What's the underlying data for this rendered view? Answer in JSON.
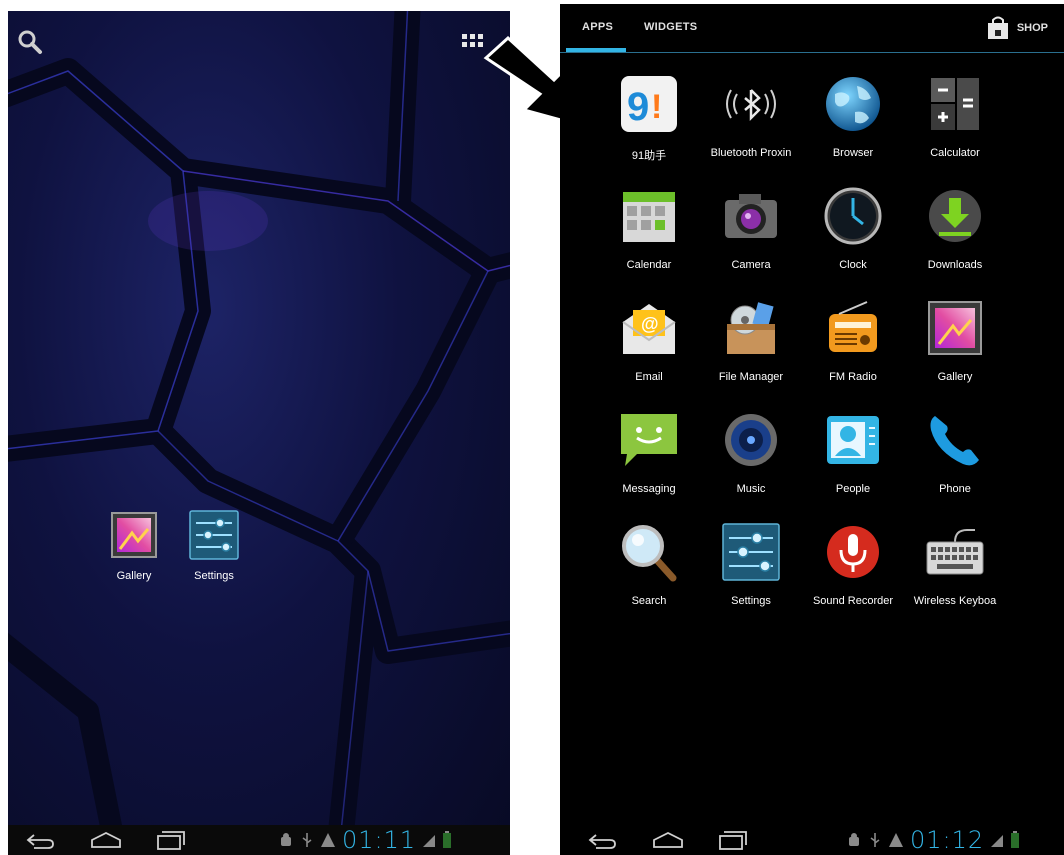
{
  "home": {
    "icons": [
      {
        "label": "Gallery",
        "icon": "gallery-icon"
      },
      {
        "label": "Settings",
        "icon": "settings-icon"
      }
    ],
    "clock": "01:11"
  },
  "drawer": {
    "tabs": [
      {
        "label": "APPS"
      },
      {
        "label": "WIDGETS"
      }
    ],
    "shop_label": "SHOP",
    "apps": [
      {
        "label": "91助手",
        "icon": "91-assistant-icon"
      },
      {
        "label": "Bluetooth Proxin",
        "icon": "bluetooth-icon"
      },
      {
        "label": "Browser",
        "icon": "globe-icon"
      },
      {
        "label": "Calculator",
        "icon": "calculator-icon"
      },
      {
        "label": "Calendar",
        "icon": "calendar-icon"
      },
      {
        "label": "Camera",
        "icon": "camera-icon"
      },
      {
        "label": "Clock",
        "icon": "clock-icon"
      },
      {
        "label": "Downloads",
        "icon": "download-icon"
      },
      {
        "label": "Email",
        "icon": "email-icon"
      },
      {
        "label": "File Manager",
        "icon": "file-manager-icon"
      },
      {
        "label": "FM Radio",
        "icon": "radio-icon"
      },
      {
        "label": "Gallery",
        "icon": "gallery-icon"
      },
      {
        "label": "Messaging",
        "icon": "messaging-icon"
      },
      {
        "label": "Music",
        "icon": "music-icon"
      },
      {
        "label": "People",
        "icon": "people-icon"
      },
      {
        "label": "Phone",
        "icon": "phone-icon"
      },
      {
        "label": "Search",
        "icon": "magnifier-icon"
      },
      {
        "label": "Settings",
        "icon": "settings-icon"
      },
      {
        "label": "Sound Recorder",
        "icon": "microphone-icon"
      },
      {
        "label": "Wireless Keyboa",
        "icon": "keyboard-icon"
      }
    ],
    "clock": "01:12"
  },
  "colors": {
    "accent": "#33b5e5",
    "wallpaper": "#10144a"
  }
}
